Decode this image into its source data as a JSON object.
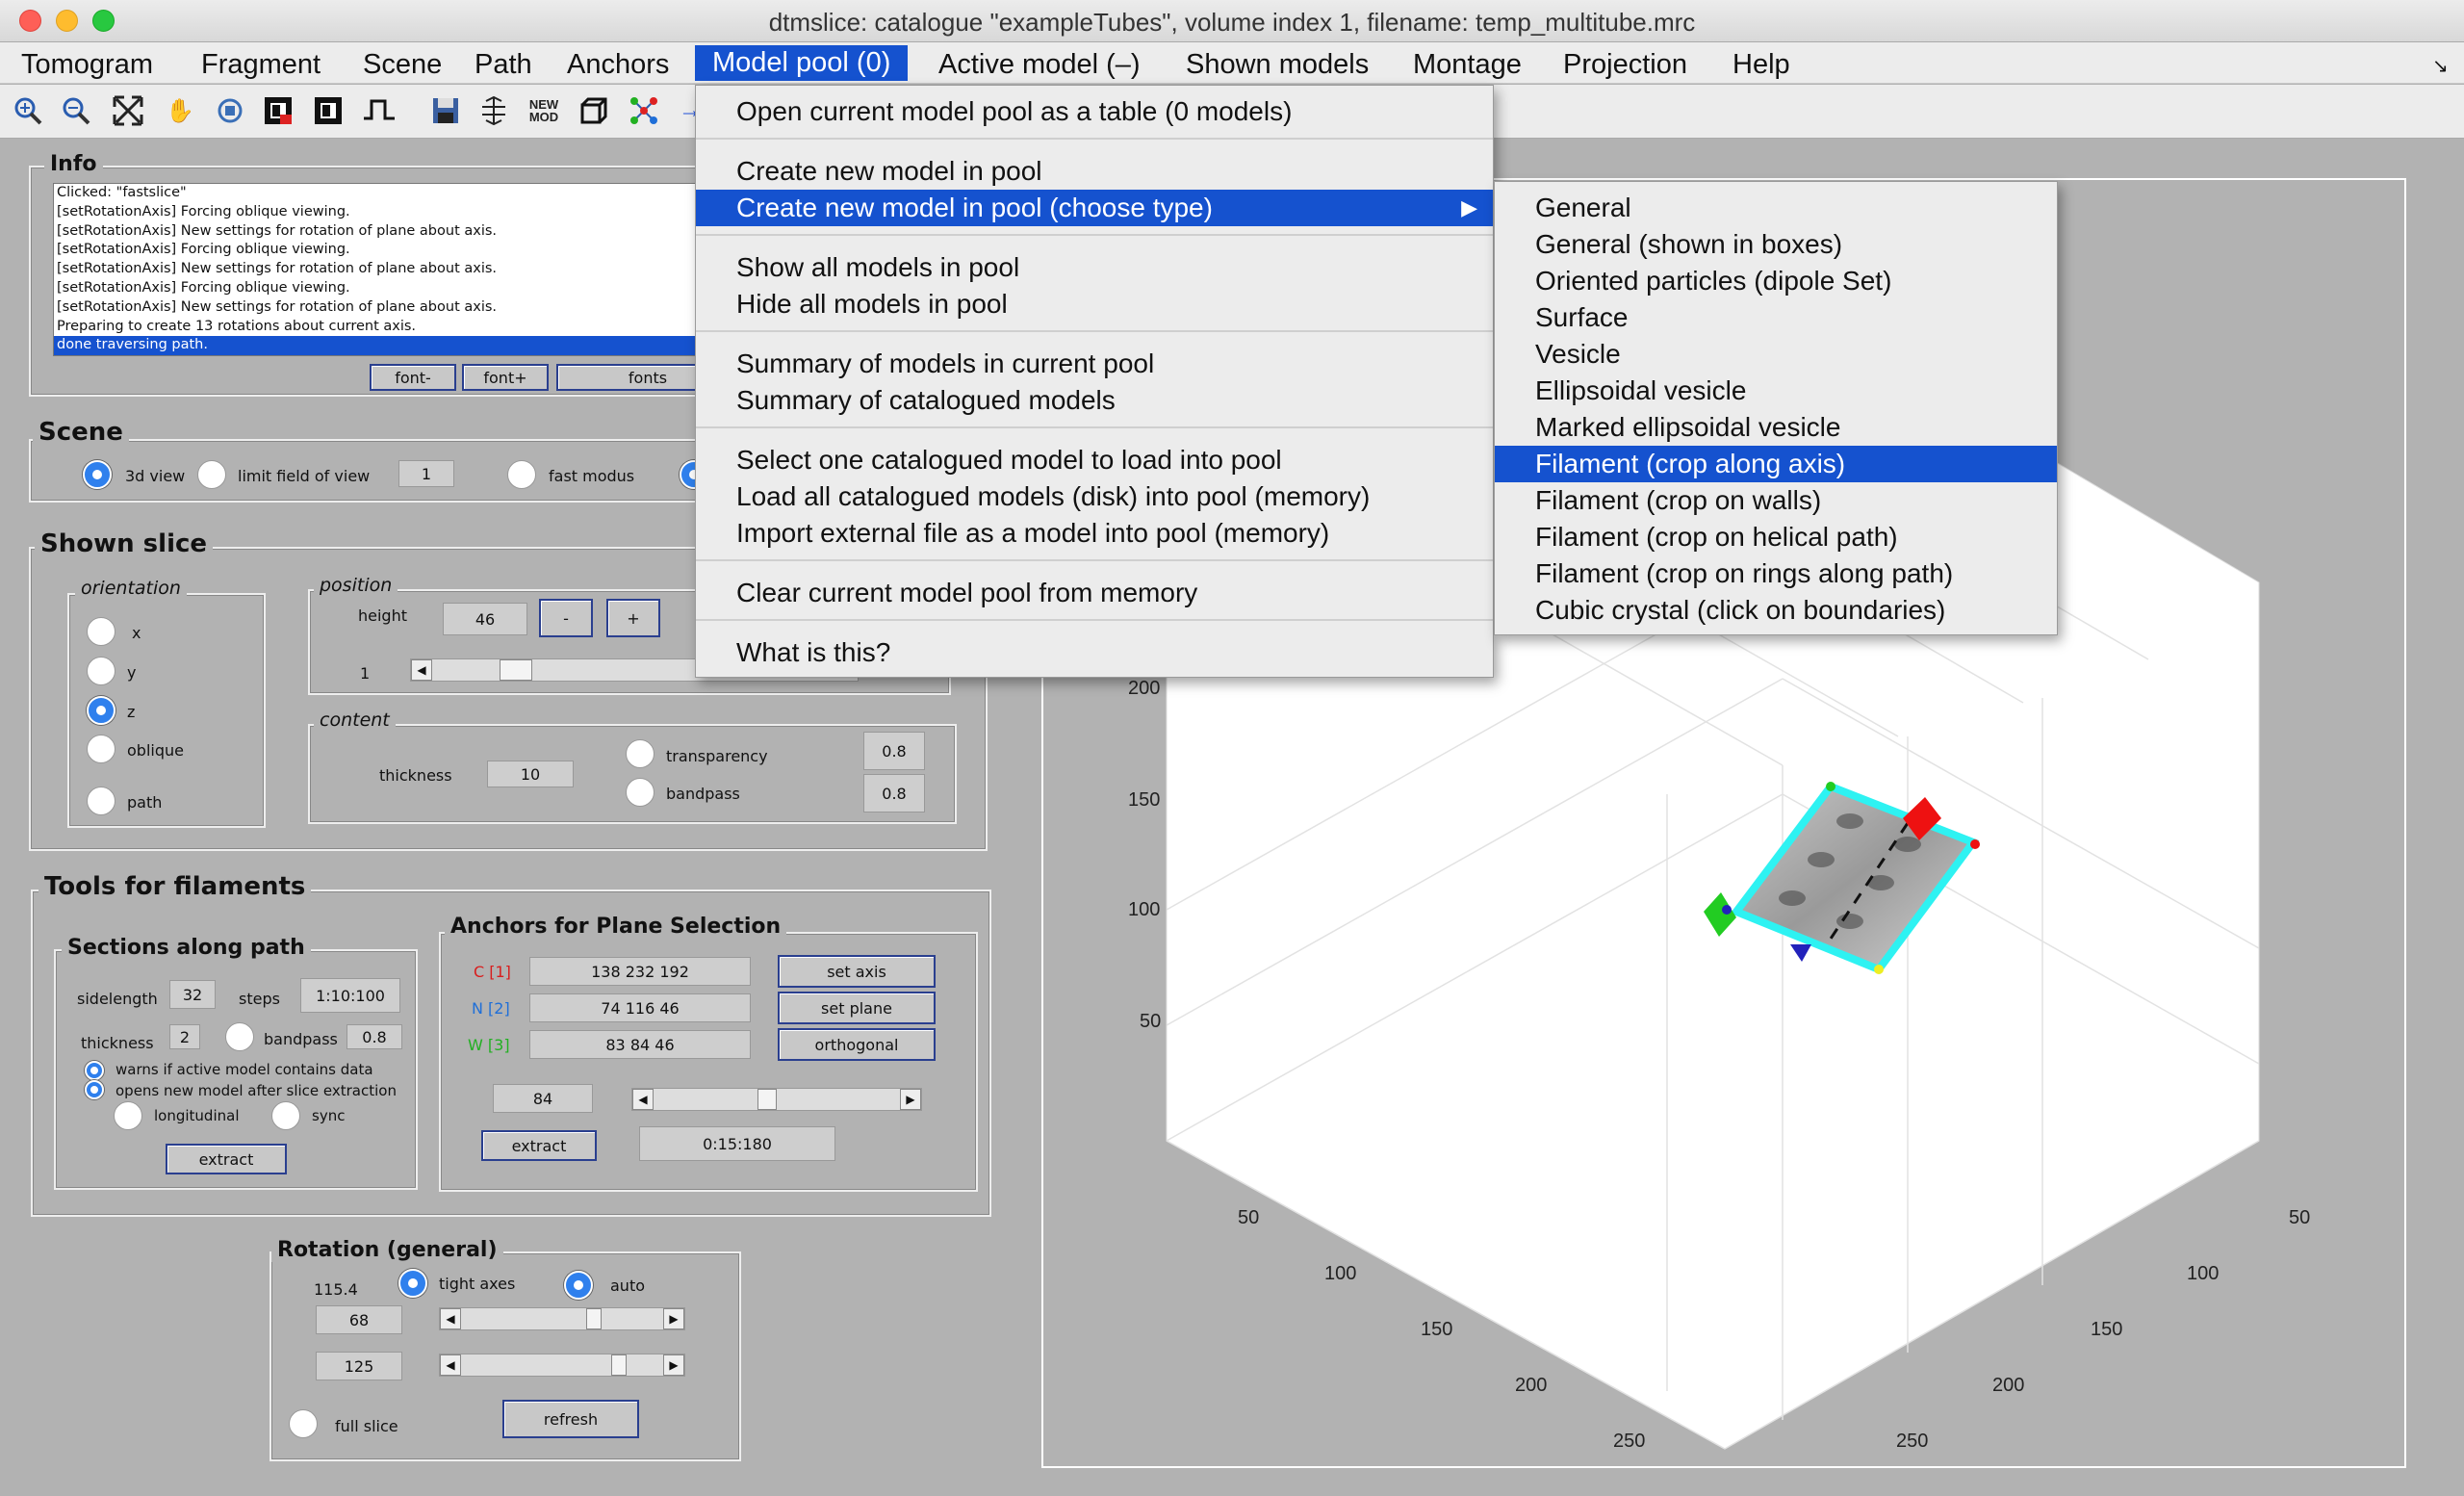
{
  "window": {
    "title": "dtmslice: catalogue \"exampleTubes\", volume index 1, filename: temp_multitube.mrc"
  },
  "menubar": {
    "items": [
      "Tomogram",
      "Fragment",
      "Scene",
      "Path",
      "Anchors",
      "Model pool (0)",
      "Active model (–)",
      "Shown models",
      "Montage",
      "Projection",
      "Help"
    ],
    "corner_glyph": "↘"
  },
  "toolbar": {
    "icons": [
      "zoom-in-icon",
      "zoom-out-icon",
      "fit-icon",
      "pan-hand-icon",
      "rotate-icon",
      "contrast-icon",
      "invert-icon",
      "step-icon",
      "save-icon",
      "slice-icon",
      "new-model-icon",
      "cube-icon",
      "graph-icon",
      "arrow-icon"
    ],
    "new_mod_label": "NEW\nMOD"
  },
  "info": {
    "title": "Info",
    "log": [
      "Clicked: \"fastslice\"",
      "[setRotationAxis] Forcing oblique viewing.",
      "[setRotationAxis] New settings for rotation of plane about axis.",
      "[setRotationAxis] Forcing oblique viewing.",
      "[setRotationAxis] New settings for rotation of plane about axis.",
      "[setRotationAxis] Forcing oblique viewing.",
      "[setRotationAxis] New settings for rotation of plane about axis.",
      "Preparing to create 13 rotations about current axis.",
      "done traversing path."
    ],
    "buttons": [
      "font-",
      "font+",
      "fonts"
    ]
  },
  "scene": {
    "title": "Scene",
    "view3d_label": "3d view",
    "limit_label": "limit field of view",
    "limit_value": "1",
    "fast_label": "fast modus"
  },
  "shown_slice": {
    "title": "Shown slice",
    "orientation_title": "orientation",
    "orientations": [
      "x",
      "y",
      "z",
      "oblique",
      "path"
    ],
    "selected": "z",
    "position_title": "position",
    "height_label": "height",
    "height_value": "46",
    "minus": "-",
    "plus": "+",
    "slider_min": "1",
    "content_title": "content",
    "thickness_label": "thickness",
    "thickness_value": "10",
    "transparency_label": "transparency",
    "transparency_value": "0.8",
    "bandpass_label": "bandpass",
    "bandpass_value": "0.8"
  },
  "filaments": {
    "title": "Tools for filaments",
    "sections_title": "Sections along path",
    "sidelength_label": "sidelength",
    "sidelength_value": "32",
    "steps_label": "steps",
    "steps_value": "1:10:100",
    "thickness_label": "thickness",
    "thickness_value": "2",
    "bandpass_label": "bandpass",
    "bandpass_value": "0.8",
    "warns_label": "warns if active model contains data",
    "opens_label": "opens new model after slice extraction",
    "longitudinal_label": "longitudinal",
    "sync_label": "sync",
    "extract_label": "extract",
    "anchors_title": "Anchors for Plane Selection",
    "c_label": "C [1]",
    "c_value": "138 232 192",
    "n_label": "N [2]",
    "n_value": "74 116 46",
    "w_label": "W [3]",
    "w_value": "83 84 46",
    "set_axis": "set axis",
    "set_plane": "set plane",
    "orthogonal": "orthogonal",
    "angle_value": "84",
    "extract2_label": "extract",
    "range_value": "0:15:180",
    "colors": {
      "c": "#d81e1e",
      "n": "#1f6fd8",
      "w": "#22b022"
    }
  },
  "rotation": {
    "title": "Rotation (general)",
    "value_top": "115.4",
    "tight_label": "tight axes",
    "auto_label": "auto",
    "az_value": "68",
    "el_value": "125",
    "full_slice_label": "full slice",
    "refresh_label": "refresh"
  },
  "plot": {
    "left_axis_ticks": [
      "200",
      "150",
      "100",
      "50"
    ],
    "bottom_left_ticks": [
      "50",
      "100",
      "150",
      "200",
      "250"
    ],
    "bottom_right_ticks": [
      "50",
      "100",
      "150",
      "200",
      "250"
    ]
  },
  "dropdown": {
    "items": [
      {
        "label": "Open current model pool as a table (0 models)"
      },
      {
        "label": "Create new model in pool"
      },
      {
        "label": "Create new model in pool (choose type)",
        "submenu": true
      },
      {
        "label": "Show all models in pool"
      },
      {
        "label": "Hide all models in pool"
      },
      {
        "label": "Summary of models in current pool"
      },
      {
        "label": "Summary of catalogued models"
      },
      {
        "label": "Select one catalogued model to load into pool"
      },
      {
        "label": "Load all catalogued models (disk) into pool (memory)"
      },
      {
        "label": "Import external file as a model into pool (memory)"
      },
      {
        "label": "Clear current model pool from memory"
      },
      {
        "label": "What is this?"
      }
    ],
    "submenu_arrow": "▶"
  },
  "submenu": {
    "items": [
      "General",
      "General (shown in boxes)",
      "Oriented particles (dipole Set)",
      "Surface",
      "Vesicle",
      "Ellipsoidal vesicle",
      "Marked ellipsoidal vesicle",
      "Filament (crop along axis)",
      "Filament (crop on walls)",
      "Filament (crop on helical path)",
      "Filament (crop on rings along path)",
      "Cubic crystal (click on boundaries)"
    ],
    "highlighted_index": 7
  }
}
